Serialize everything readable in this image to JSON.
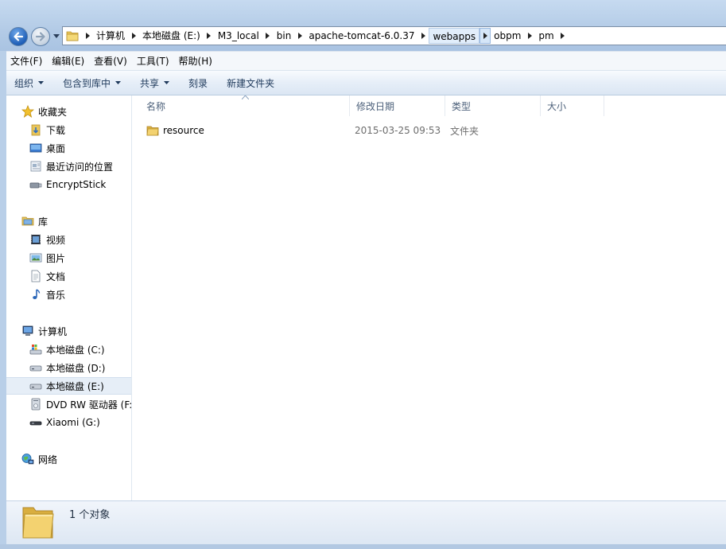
{
  "address": {
    "crumbs": [
      "计算机",
      "本地磁盘 (E:)",
      "M3_local",
      "bin",
      "apache-tomcat-6.0.37",
      "webapps",
      "obpm",
      "pm"
    ]
  },
  "menu": [
    "文件(F)",
    "编辑(E)",
    "查看(V)",
    "工具(T)",
    "帮助(H)"
  ],
  "toolbar": {
    "organize": "组织",
    "include_library": "包含到库中",
    "share": "共享",
    "burn": "刻录",
    "new_folder": "新建文件夹"
  },
  "nav": {
    "favorites": {
      "label": "收藏夹",
      "items": [
        "下载",
        "桌面",
        "最近访问的位置",
        "EncryptStick"
      ]
    },
    "libraries": {
      "label": "库",
      "items": [
        "视频",
        "图片",
        "文档",
        "音乐"
      ]
    },
    "computer": {
      "label": "计算机",
      "items": [
        "本地磁盘 (C:)",
        "本地磁盘 (D:)",
        "本地磁盘 (E:)",
        "DVD RW 驱动器 (F:",
        "Xiaomi (G:)"
      ]
    },
    "network": {
      "label": "网络"
    }
  },
  "columns": {
    "name": "名称",
    "date": "修改日期",
    "type": "类型",
    "size": "大小"
  },
  "files": [
    {
      "name": "resource",
      "date": "2015-03-25 09:53",
      "type": "文件夹"
    }
  ],
  "details": {
    "count_text": "1 个对象"
  },
  "colors": {
    "accent": "#1f5fb8",
    "folder": "#e8c55a",
    "selection": "#e6eef7"
  }
}
